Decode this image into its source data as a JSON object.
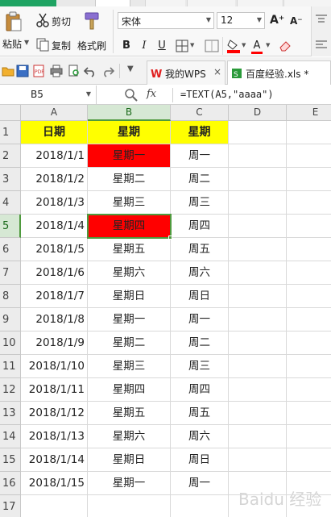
{
  "ribbon": {
    "paste_label": "粘贴",
    "cut_label": "剪切",
    "copy_label": "复制",
    "brush_label": "格式刷",
    "font_name": "宋体",
    "font_size": "12",
    "bold": "B",
    "italic": "I",
    "underline": "U",
    "grow_font": "A⁺",
    "shrink_font": "A⁻",
    "font_color_letter": "A",
    "accent_green": "#1fa463"
  },
  "doc_tabs": [
    {
      "label": "我的WPS",
      "close": "×"
    },
    {
      "label": "百度经验.xls *"
    }
  ],
  "formula_bar": {
    "cell_ref": "B5",
    "fx_label": "fx",
    "formula": "=TEXT(A5,\"aaaa\")"
  },
  "columns": [
    "A",
    "B",
    "C",
    "D",
    "E"
  ],
  "rows": [
    "1",
    "2",
    "3",
    "4",
    "5",
    "6",
    "7",
    "8",
    "9",
    "10",
    "11",
    "12",
    "13",
    "14",
    "15",
    "16",
    "17"
  ],
  "header_row": [
    "日期",
    "星期",
    "星期"
  ],
  "data_rows": [
    [
      "2018/1/1",
      "星期一",
      "周一"
    ],
    [
      "2018/1/2",
      "星期二",
      "周二"
    ],
    [
      "2018/1/3",
      "星期三",
      "周三"
    ],
    [
      "2018/1/4",
      "星期四",
      "周四"
    ],
    [
      "2018/1/5",
      "星期五",
      "周五"
    ],
    [
      "2018/1/6",
      "星期六",
      "周六"
    ],
    [
      "2018/1/7",
      "星期日",
      "周日"
    ],
    [
      "2018/1/8",
      "星期一",
      "周一"
    ],
    [
      "2018/1/9",
      "星期二",
      "周二"
    ],
    [
      "2018/1/10",
      "星期三",
      "周三"
    ],
    [
      "2018/1/11",
      "星期四",
      "周四"
    ],
    [
      "2018/1/12",
      "星期五",
      "周五"
    ],
    [
      "2018/1/13",
      "星期六",
      "周六"
    ],
    [
      "2018/1/14",
      "星期日",
      "周日"
    ],
    [
      "2018/1/15",
      "星期一",
      "周一"
    ]
  ],
  "colors": {
    "header_fill": "#ffff00",
    "highlight_fill": "#ff0000",
    "selection": "#4f9a3e"
  },
  "watermark": "Baidu 经验"
}
